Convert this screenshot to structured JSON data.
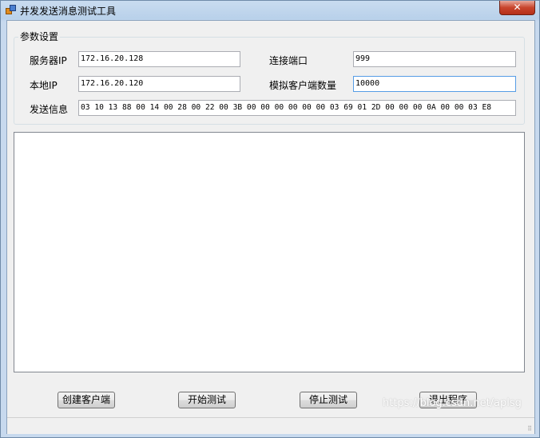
{
  "window": {
    "title": "并发发送消息测试工具",
    "close_label": "✕"
  },
  "settings": {
    "group_title": "参数设置",
    "server_ip_label": "服务器IP",
    "server_ip_value": "172.16.20.128",
    "port_label": "连接端口",
    "port_value": "999",
    "local_ip_label": "本地IP",
    "local_ip_value": "172.16.20.120",
    "client_count_label": "模拟客户端数量",
    "client_count_value": "10000",
    "message_label": "发送信息",
    "message_value": "03 10 13 88 00 14 00 28 00 22 00 3B 00 00 00 00 00 00 03 69 01 2D 00 00 00 0A 00 00 03 E8"
  },
  "buttons": {
    "create_clients": "创建客户端",
    "start_test": "开始测试",
    "stop_test": "停止测试",
    "exit": "退出程序"
  },
  "status": {
    "watermark": "https://blog.csdn.net/aplsg"
  }
}
